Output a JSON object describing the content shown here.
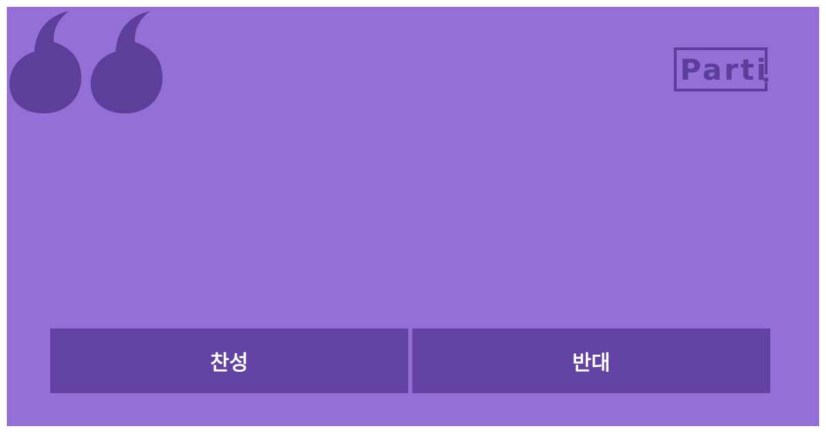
{
  "theme": {
    "background": "#9470d6",
    "accent_dark": "#5b3f9b",
    "button": "#6243a3",
    "button_text": "#ffffff"
  },
  "decor": {
    "quote_icon": "open-quote-icon"
  },
  "logo": {
    "text": "Parti"
  },
  "vote": {
    "agree_label": "찬성",
    "disagree_label": "반대"
  }
}
